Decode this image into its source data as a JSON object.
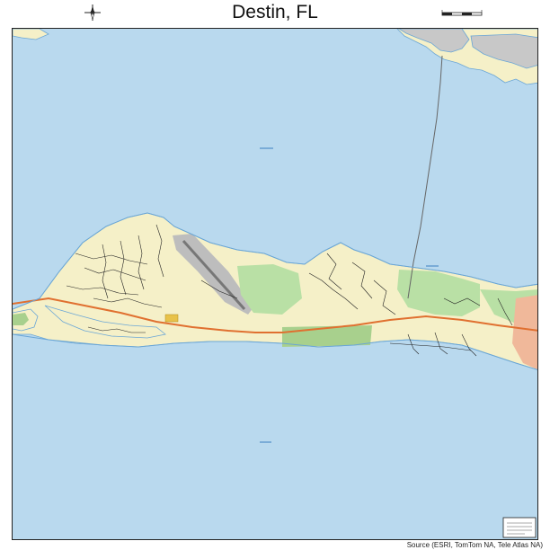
{
  "map": {
    "title": "Destin, FL",
    "source_note": "Source (ESRI, TomTom NA, Tele Atlas NA)",
    "colors": {
      "water": "#b9d9ee",
      "land": "#f5f0c8",
      "urban": "#c8c8c8",
      "park": "#b9e0a5",
      "green": "#a8d08d",
      "major_road": "#e07030",
      "road": "#222222",
      "shore": "#6aa6d6",
      "airport": "#bdbdbd",
      "coast_pink": "#f0b89a"
    },
    "icons": {
      "north_arrow": "compass-rose-icon",
      "scale_bar": "scale-bar-icon",
      "legend": "legend-box-icon"
    }
  }
}
